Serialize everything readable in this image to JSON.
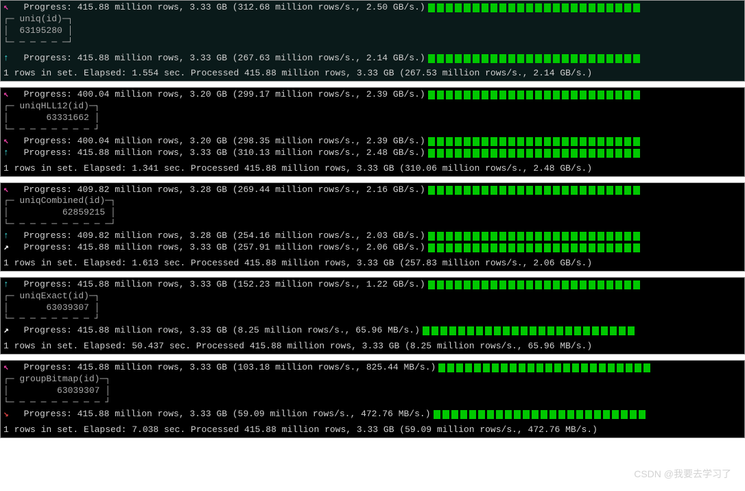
{
  "watermark": "CSDN @我要去学习了",
  "panels": [
    {
      "lines": [
        {
          "arrow": "magenta",
          "arrowChar": "↖",
          "text": "  Progress: 415.88 million rows, 3.33 GB (312.68 million rows/s., 2.50 GB/s.)",
          "bars": true
        },
        {
          "box": "┌─ uniq(id)─┐"
        },
        {
          "box": "│  63195280 │"
        },
        {
          "box": "└─ ─ ─ ─ ─ ─┘"
        },
        {
          "blank": true
        },
        {
          "arrow": "cyan",
          "arrowChar": "↑",
          "text": "  Progress: 415.88 million rows, 3.33 GB (267.63 million rows/s., 2.14 GB/s.)",
          "bars": true
        },
        {
          "blank": true
        },
        {
          "summary": "1 rows in set. Elapsed: 1.554 sec. Processed 415.88 million rows, 3.33 GB (267.53 million rows/s., 2.14 GB/s.)"
        }
      ]
    },
    {
      "lines": [
        {
          "arrow": "magenta",
          "arrowChar": "↖",
          "text": "  Progress: 400.04 million rows, 3.20 GB (299.17 million rows/s., 2.39 GB/s.)",
          "bars": true
        },
        {
          "box": "┌─ uniqHLL12(id)─┐"
        },
        {
          "box": "│       63331662 │"
        },
        {
          "box": "└─ ─ ─ ─ ─ ─ ─ ─ ┘"
        },
        {
          "arrow": "magenta",
          "arrowChar": "↖",
          "text": "  Progress: 400.04 million rows, 3.20 GB (298.35 million rows/s., 2.39 GB/s.)",
          "bars": true
        },
        {
          "arrow": "cyan",
          "arrowChar": "↑",
          "text": "  Progress: 415.88 million rows, 3.33 GB (310.13 million rows/s., 2.48 GB/s.)",
          "bars": true
        },
        {
          "blank": true
        },
        {
          "summary": "1 rows in set. Elapsed: 1.341 sec. Processed 415.88 million rows, 3.33 GB (310.06 million rows/s., 2.48 GB/s.)"
        }
      ]
    },
    {
      "lines": [
        {
          "arrow": "magenta",
          "arrowChar": "↖",
          "text": "  Progress: 409.82 million rows, 3.28 GB (269.44 million rows/s., 2.16 GB/s.)",
          "bars": true
        },
        {
          "box": "┌─ uniqCombined(id)─┐"
        },
        {
          "box": "│          62859215 │"
        },
        {
          "box": "└─ ─ ─ ─ ─ ─ ─ ─ ─ ─┘"
        },
        {
          "arrow": "cyan",
          "arrowChar": "↑",
          "text": "  Progress: 409.82 million rows, 3.28 GB (254.16 million rows/s., 2.03 GB/s.)",
          "bars": true
        },
        {
          "arrow": "white",
          "arrowChar": "↗",
          "text": "  Progress: 415.88 million rows, 3.33 GB (257.91 million rows/s., 2.06 GB/s.)",
          "bars": true
        },
        {
          "blank": true
        },
        {
          "summary": "1 rows in set. Elapsed: 1.613 sec. Processed 415.88 million rows, 3.33 GB (257.83 million rows/s., 2.06 GB/s.)"
        }
      ]
    },
    {
      "lines": [
        {
          "arrow": "cyan",
          "arrowChar": "↑",
          "text": "  Progress: 415.88 million rows, 3.33 GB (152.23 million rows/s., 1.22 GB/s.)",
          "bars": true
        },
        {
          "box": "┌─ uniqExact(id)─┐"
        },
        {
          "box": "│       63039307 │"
        },
        {
          "box": "└─ ─ ─ ─ ─ ─ ─ ─ ┘"
        },
        {
          "arrow": "white",
          "arrowChar": "↗",
          "text": "  Progress: 415.88 million rows, 3.33 GB (8.25 million rows/s., 65.96 MB/s.)",
          "bars": true
        },
        {
          "blank": true
        },
        {
          "summary": "1 rows in set. Elapsed: 50.437 sec. Processed 415.88 million rows, 3.33 GB (8.25 million rows/s., 65.96 MB/s.)"
        }
      ]
    },
    {
      "lines": [
        {
          "arrow": "magenta",
          "arrowChar": "↖",
          "text": "  Progress: 415.88 million rows, 3.33 GB (103.18 million rows/s., 825.44 MB/s.)",
          "bars": true
        },
        {
          "box": "┌─ groupBitmap(id)─┐"
        },
        {
          "box": "│         63039307 │"
        },
        {
          "box": "└─ ─ ─ ─ ─ ─ ─ ─ ─ ┘"
        },
        {
          "arrow": "red",
          "arrowChar": "↘",
          "text": "  Progress: 415.88 million rows, 3.33 GB (59.09 million rows/s., 472.76 MB/s.)",
          "bars": true
        },
        {
          "blank": true
        },
        {
          "summary": "1 rows in set. Elapsed: 7.038 sec. Processed 415.88 million rows, 3.33 GB (59.09 million rows/s., 472.76 MB/s.)"
        }
      ]
    }
  ]
}
